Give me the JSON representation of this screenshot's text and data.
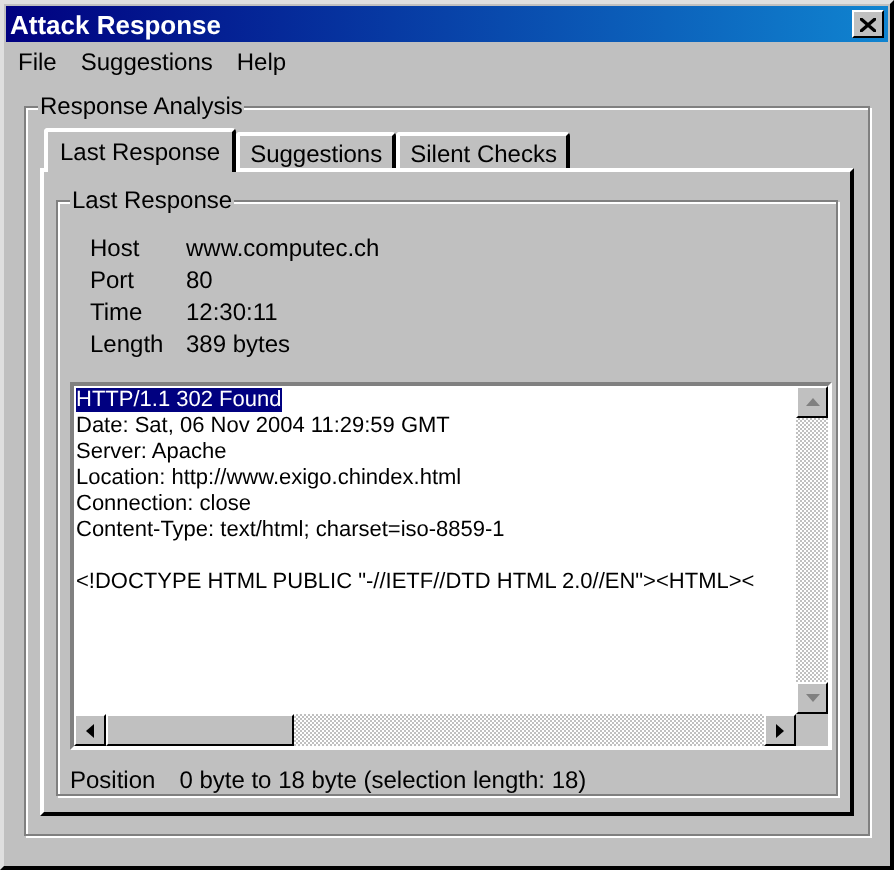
{
  "window": {
    "title": "Attack Response"
  },
  "menu": [
    {
      "label": "File"
    },
    {
      "label": "Suggestions"
    },
    {
      "label": "Help"
    }
  ],
  "group": {
    "title": "Response Analysis"
  },
  "tabs": [
    {
      "label": "Last Response",
      "selected": true
    },
    {
      "label": "Suggestions",
      "selected": false
    },
    {
      "label": "Silent Checks",
      "selected": false
    }
  ],
  "panel": {
    "title": "Last Response",
    "fields": [
      {
        "label": "Host",
        "value": "www.computec.ch"
      },
      {
        "label": "Port",
        "value": "80"
      },
      {
        "label": "Time",
        "value": "12:30:11"
      },
      {
        "label": "Length",
        "value": "389 bytes"
      }
    ],
    "response_lines": [
      {
        "text": "HTTP/1.1 302 Found",
        "selected": true,
        "gap_before": false
      },
      {
        "text": "Date: Sat, 06 Nov 2004 11:29:59 GMT",
        "selected": false,
        "gap_before": false
      },
      {
        "text": "Server: Apache",
        "selected": false,
        "gap_before": false
      },
      {
        "text": "Location: http://www.exigo.chindex.html",
        "selected": false,
        "gap_before": false
      },
      {
        "text": "Connection: close",
        "selected": false,
        "gap_before": false
      },
      {
        "text": "Content-Type: text/html; charset=iso-8859-1",
        "selected": false,
        "gap_before": false
      },
      {
        "text": "<!DOCTYPE HTML PUBLIC \"-//IETF//DTD HTML 2.0//EN\"><HTML><",
        "selected": false,
        "gap_before": true
      }
    ],
    "position": {
      "label": "Position",
      "value": "0 byte to 18 byte (selection length: 18)"
    }
  }
}
